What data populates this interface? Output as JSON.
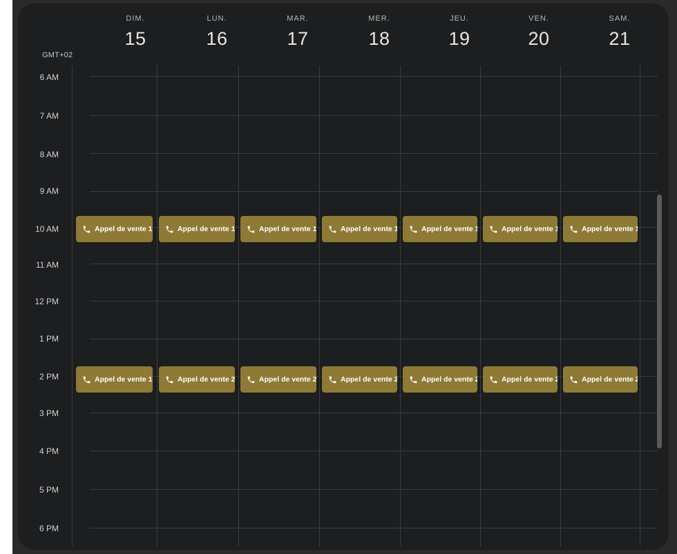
{
  "timezone": "GMT+02",
  "days": [
    {
      "dow": "DIM.",
      "num": "15"
    },
    {
      "dow": "LUN.",
      "num": "16"
    },
    {
      "dow": "MAR.",
      "num": "17"
    },
    {
      "dow": "MER.",
      "num": "18"
    },
    {
      "dow": "JEU.",
      "num": "19"
    },
    {
      "dow": "VEN.",
      "num": "20"
    },
    {
      "dow": "SAM.",
      "num": "21"
    }
  ],
  "hours": [
    "6 AM",
    "7 AM",
    "8 AM",
    "9 AM",
    "10 AM",
    "11 AM",
    "12 PM",
    "1 PM",
    "2 PM",
    "3 PM",
    "4 PM",
    "5 PM",
    "6 PM"
  ],
  "events": {
    "row_10am": [
      "Appel de vente 1",
      "Appel de vente 1",
      "Appel de vente 1",
      "Appel de vente 1",
      "Appel de vente 1",
      "Appel de vente 1",
      "Appel de vente 1"
    ],
    "row_2pm": [
      "Appel de vente 1",
      "Appel de vente 2",
      "Appel de vente 2",
      "Appel de vente 2",
      "Appel de vente 2",
      "Appel de vente 2",
      "Appel de vente 2"
    ],
    "icon": "phone-icon"
  },
  "colors": {
    "background": "#1d1e20",
    "event": "#8e7a35",
    "gridline": "#3b3c3e",
    "text": "#e6e6e6"
  }
}
